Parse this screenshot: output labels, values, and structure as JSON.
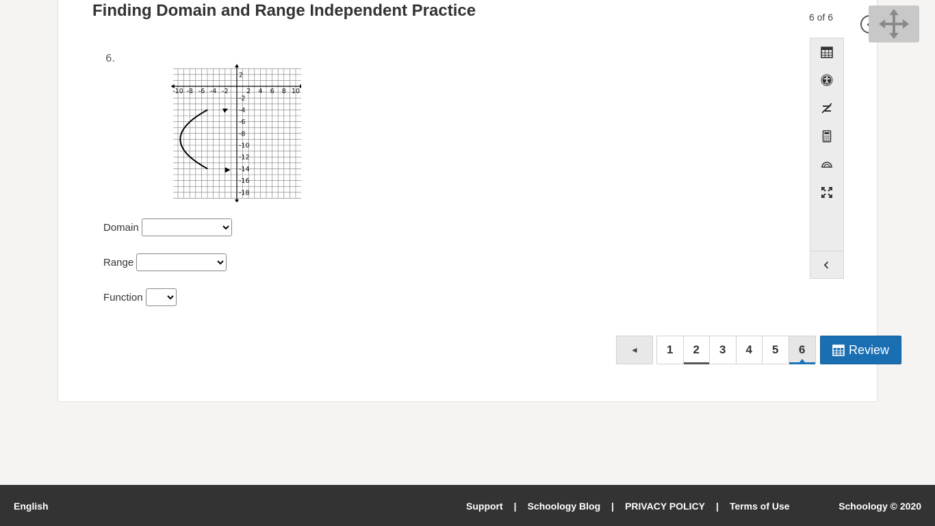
{
  "header": {
    "title": "Finding Domain and Range Independent Practice",
    "counter": "6 of 6"
  },
  "question": {
    "number": "6.",
    "graph": {
      "x_ticks": [
        "-10",
        "-8",
        "-6",
        "-4",
        "-2",
        "2",
        "4",
        "6",
        "8",
        "10"
      ],
      "y_ticks": [
        "2",
        "-2",
        "-4",
        "-6",
        "-8",
        "-10",
        "-12",
        "-14",
        "-16",
        "-18"
      ]
    },
    "fields": {
      "domain_label": "Domain",
      "range_label": "Range",
      "function_label": "Function"
    }
  },
  "tools": [
    {
      "name": "calendar-icon"
    },
    {
      "name": "accessibility-icon"
    },
    {
      "name": "eliminate-answer-icon"
    },
    {
      "name": "calculator-icon"
    },
    {
      "name": "protractor-icon"
    },
    {
      "name": "fullscreen-icon"
    }
  ],
  "pager": {
    "prev_label": "◄",
    "pages": [
      "1",
      "2",
      "3",
      "4",
      "5",
      "6"
    ],
    "current": "6",
    "review_label": "Review"
  },
  "footer": {
    "language": "English",
    "links": [
      "Support",
      "Schoology Blog",
      "PRIVACY POLICY",
      "Terms of Use"
    ],
    "copyright": "Schoology © 2020"
  },
  "colors": {
    "accent": "#1a6fb3",
    "footer_bg": "#333333",
    "page_bg": "#f5f4f2"
  }
}
